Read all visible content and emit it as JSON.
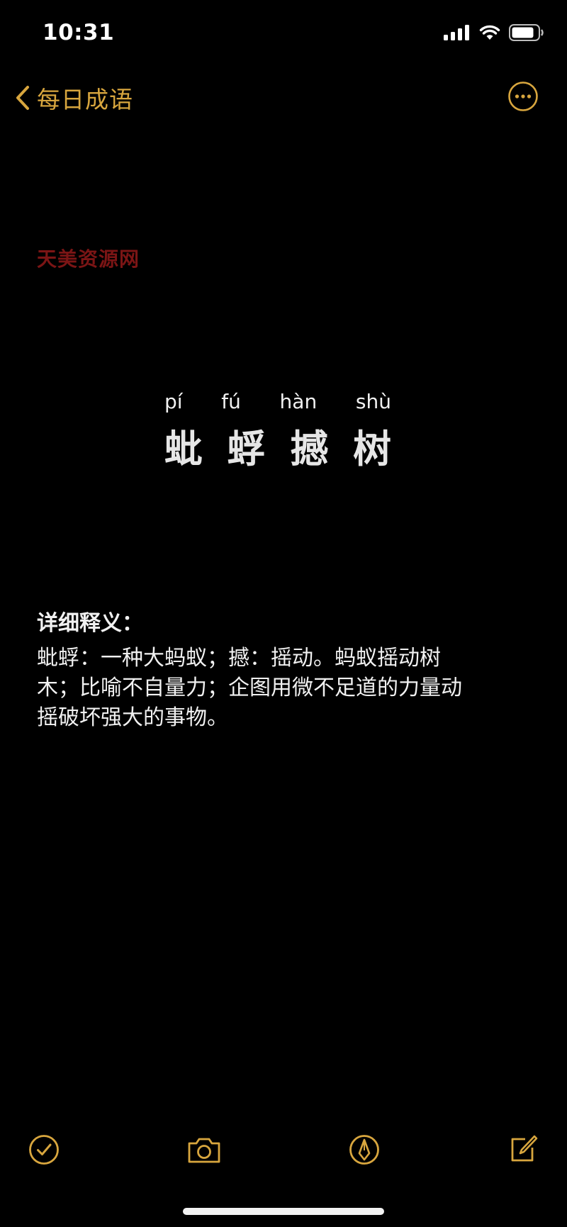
{
  "status": {
    "time": "10:31",
    "icons": [
      "cellular-signal-icon",
      "wifi-icon",
      "battery-icon"
    ]
  },
  "nav": {
    "back_label": "每日成语",
    "back_icon": "chevron-left-icon",
    "more_icon": "more-ellipsis-icon"
  },
  "watermark": "天美资源网",
  "idiom": {
    "pinyin": [
      "pí",
      "fú",
      "hàn",
      "shù"
    ],
    "chars": [
      "蚍",
      "蜉",
      "撼",
      "树"
    ]
  },
  "definition": {
    "heading": "详细释义：",
    "lines": [
      "蚍蜉：一种大蚂蚁；撼：摇动。蚂蚁摇动树",
      "木；比喻不自量力；企图用微不足道的力量动",
      "摇破坏强大的事物。"
    ]
  },
  "toolbar": {
    "buttons": [
      "checklist-icon",
      "camera-icon",
      "markup-pen-icon",
      "compose-icon"
    ]
  },
  "colors": {
    "accent": "#d8a63e",
    "background": "#000000",
    "text": "#f1f1f1",
    "watermark": "#7b1515"
  }
}
